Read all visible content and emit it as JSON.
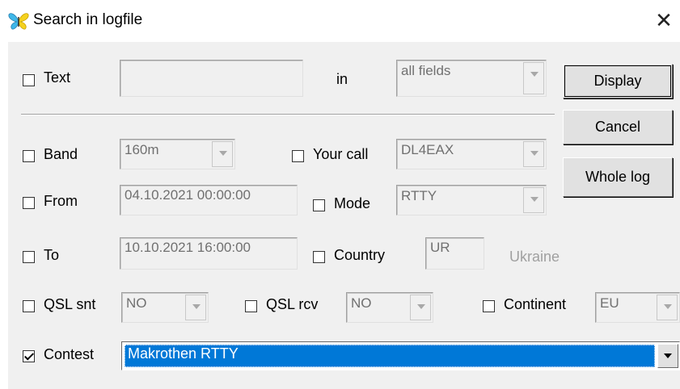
{
  "window": {
    "title": "Search in logfile",
    "close_glyph": "✕",
    "icon": "butterfly-icon"
  },
  "text_row": {
    "checkbox_label": "Text",
    "checked": false,
    "text_value": "",
    "in_label": "in",
    "fields_value": "all fields"
  },
  "buttons": {
    "display": "Display",
    "cancel": "Cancel",
    "whole_log": "Whole log"
  },
  "band_row": {
    "band_label": "Band",
    "band_checked": false,
    "band_value": "160m",
    "your_call_label": "Your call",
    "your_call_checked": false,
    "your_call_value": "DL4EAX"
  },
  "from_row": {
    "from_label": "From",
    "from_checked": false,
    "from_value": "04.10.2021 00:00:00",
    "mode_label": "Mode",
    "mode_checked": false,
    "mode_value": "RTTY"
  },
  "to_row": {
    "to_label": "To",
    "to_checked": false,
    "to_value": "10.10.2021 16:00:00",
    "country_label": "Country",
    "country_checked": false,
    "country_value": "UR",
    "country_name": "Ukraine"
  },
  "qsl_row": {
    "qsl_snt_label": "QSL snt",
    "qsl_snt_checked": false,
    "qsl_snt_value": "NO",
    "qsl_rcv_label": "QSL rcv",
    "qsl_rcv_checked": false,
    "qsl_rcv_value": "NO",
    "continent_label": "Continent",
    "continent_checked": false,
    "continent_value": "EU"
  },
  "contest_row": {
    "contest_label": "Contest",
    "contest_checked": true,
    "contest_value": "Makrothen RTTY"
  },
  "colors": {
    "selection": "#0078d7",
    "dialog_bg": "#f0f0f0",
    "disabled_text": "#a0a0a0"
  }
}
